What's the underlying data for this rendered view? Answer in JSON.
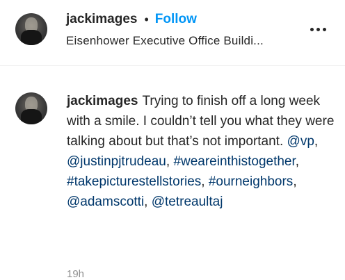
{
  "post_header": {
    "username": "jackimages",
    "separator": "•",
    "follow_label": "Follow",
    "location": "Eisenhower Executive Office Buildi..."
  },
  "comment": {
    "username": "jackimages",
    "text": "Trying to finish off a long week with a smile. I couldn’t tell you what they were talking about but that’s not important.",
    "mentions": [
      "@vp",
      "@justinpjtrudeau",
      "@adamscotti",
      "@tetreaultaj"
    ],
    "hashtags": [
      "#weareinthistogether",
      "#takepicturestellstories",
      "#ourneighbors"
    ],
    "punct": {
      "comma": ","
    },
    "timestamp": "19h"
  },
  "icons": {
    "more": "more-options-icon"
  },
  "colors": {
    "follow": "#0095f6",
    "link": "#00376b",
    "text": "#262626",
    "muted": "#8e8e8e",
    "divider": "#efefef"
  }
}
